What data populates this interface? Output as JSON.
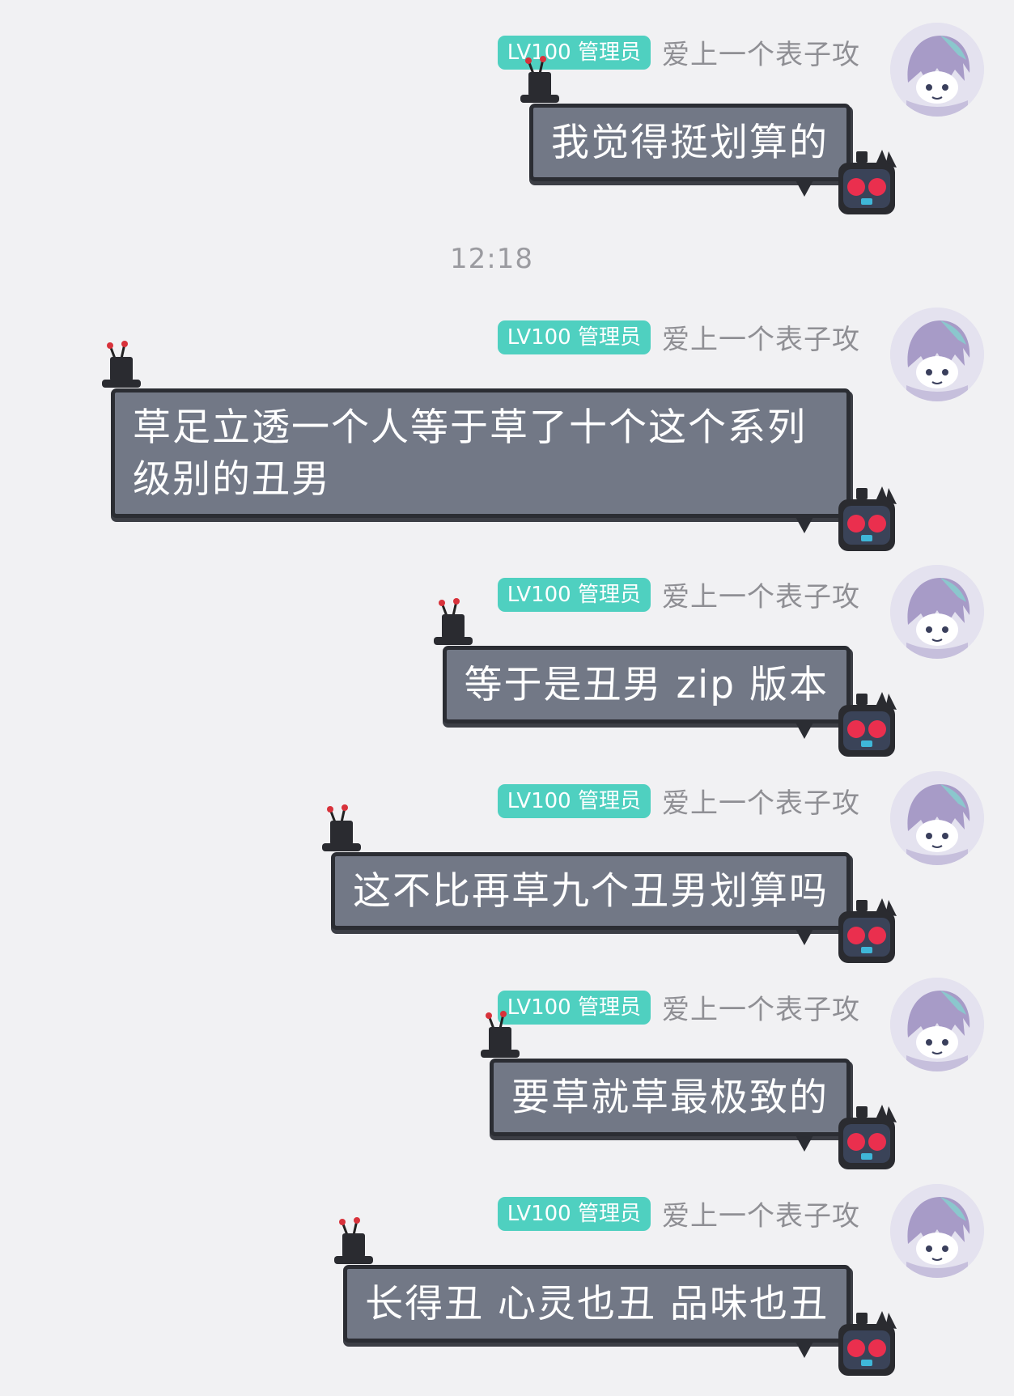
{
  "timestamp": "12:18",
  "messages": [
    {
      "badge": "LV100 管理员",
      "sender": "爱上一个表子攻",
      "text": "我觉得挺划算的"
    },
    {
      "badge": "LV100 管理员",
      "sender": "爱上一个表子攻",
      "text": "草足立透一个人等于草了十个这个系列级别的丑男"
    },
    {
      "badge": "LV100 管理员",
      "sender": "爱上一个表子攻",
      "text": "等于是丑男 zip 版本"
    },
    {
      "badge": "LV100 管理员",
      "sender": "爱上一个表子攻",
      "text": "这不比再草九个丑男划算吗"
    },
    {
      "badge": "LV100 管理员",
      "sender": "爱上一个表子攻",
      "text": "要草就草最极致的"
    },
    {
      "badge": "LV100 管理员",
      "sender": "爱上一个表子攻",
      "text": "长得丑 心灵也丑 品味也丑"
    }
  ],
  "colors": {
    "background": "#f1f1f3",
    "badge": "#4fd0c0",
    "bubble": "#727886",
    "bubble_border": "#2b2d33",
    "sender": "#8f8f94"
  },
  "icons": [
    "avatar",
    "top-hat-icon",
    "robot-cat-icon"
  ]
}
